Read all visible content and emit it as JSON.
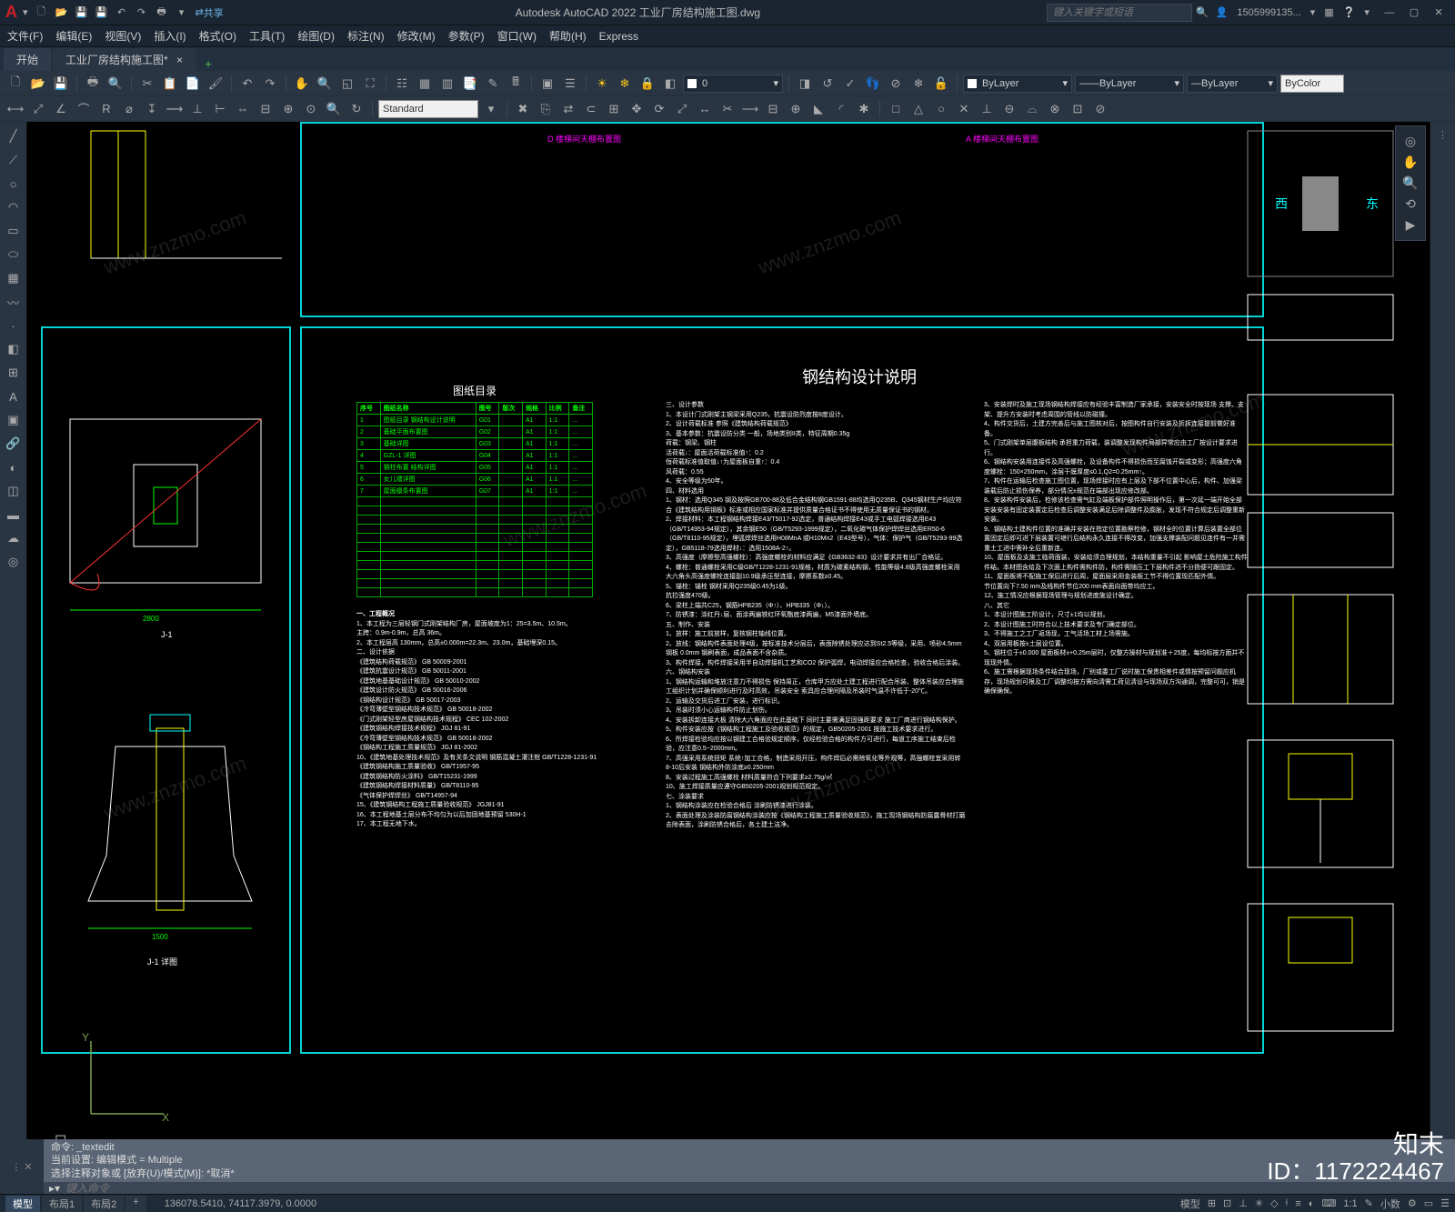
{
  "app": {
    "title": "Autodesk AutoCAD 2022   工业厂房结构施工图.dwg",
    "user": "1505999135...",
    "search_placeholder": "键入关键字或短语",
    "share": "共享"
  },
  "menu": [
    "文件(F)",
    "编辑(E)",
    "视图(V)",
    "插入(I)",
    "格式(O)",
    "工具(T)",
    "绘图(D)",
    "标注(N)",
    "修改(M)",
    "参数(P)",
    "窗口(W)",
    "帮助(H)",
    "Express"
  ],
  "tabs": {
    "start": "开始",
    "doc": "工业厂房结构施工图*",
    "plus": "+"
  },
  "toolbar": {
    "layer_value": "0",
    "style_value": "Standard",
    "bylayer": "ByLayer",
    "bycolor": "ByColor"
  },
  "drawing": {
    "label_d": "D 楼梯间天棚布置图",
    "label_a": "A 楼梯间天棚布置图",
    "spec_title": "钢结构设计说明",
    "catalog_title": "图纸目录",
    "catalog_headers": [
      "序号",
      "图纸名称",
      "图号",
      "版次",
      "规格",
      "比例",
      "备注"
    ],
    "catalog_rows": [
      [
        "1",
        "图纸目录 钢结构设计说明",
        "G01",
        "",
        "A1",
        "1:1",
        "..."
      ],
      [
        "2",
        "基础平面布置图",
        "G02",
        "",
        "A1",
        "1:1",
        "..."
      ],
      [
        "3",
        "基础详图",
        "G03",
        "",
        "A1",
        "1:1",
        "..."
      ],
      [
        "4",
        "GZL-1 详图",
        "G04",
        "",
        "A1",
        "1:1",
        "..."
      ],
      [
        "5",
        "钢柱布置 结构详图",
        "G05",
        "",
        "A1",
        "1:1",
        "..."
      ],
      [
        "6",
        "女儿墙详图",
        "G06",
        "",
        "A1",
        "1:1",
        "..."
      ],
      [
        "7",
        "屋面檩条布置图",
        "G07",
        "",
        "A1",
        "1:1",
        "..."
      ]
    ],
    "eng_title": "一、工程概况",
    "eng_lines": [
      "1、本工程为三层轻钢门式刚架结构厂房，屋面坡度为1：25=3.5m、10.5m。",
      "主跨：0.9m-0.9m，总高 36m。",
      "2、本工程层高 130mm，总高±0.000m=22.3m、23.0m，基础埋深0.15。",
      "二、设计依据",
      "《建筑结构荷载规范》 GB 50009-2001",
      "《建筑抗震设计规范》 GB 50011-2001",
      "《建筑地基基础设计规范》 GB 50010-2002",
      "《建筑设计防火规范》 GB 50016-2006",
      "《钢结构设计规范》 GB 50017-2003",
      "《冷弯薄壁型钢结构技术规范》 GB 50018-2002",
      "《门式刚架轻型房屋钢结构技术规程》 CEC 102-2002",
      "《建筑钢结构焊接技术规程》 JGJ 81-91",
      "《冷弯薄壁型钢结构技术规范》 GB 50018-2002",
      "《钢结构工程施工质量规范》 JGJ 81-2002",
      "10、《建筑地基处理技术规范》及有关条文说明 钢筋混凝土灌注桩 GB/T1228-1231-91",
      "《建筑钢结构施工质量验收》 GB/T1957-95",
      "《建筑钢结构防火涂料》 GB/T15231-1999",
      "《建筑钢结构焊接材料质量》 GB/T8110-95",
      "《气体保护焊焊丝》 GB/T14957-94",
      "15、《建筑钢结构工程施工质量验收规范》 JGJ81-91",
      "16、本工程地基土层分布不均匀为以后加固地基预留 530H-1",
      "17、本工程无地下水。"
    ],
    "spec_sections": [
      "三、设计参数",
      "1、本设计门式刚架主钢梁采用Q235，抗震设防烈度按8度设计。",
      "2、设计荷载标准 参照《建筑结构荷载规范》",
      "3、基本参数：抗震设防分类 一般，场地类别II类，特征周期0.35g",
      "荷载：钢梁、钢柱",
      "活荷载↓：屋面活荷载标准值↑：0.2",
      "恒荷载标准值取值↓↑为屋面板自重↑：0.4",
      "风荷载：0.55",
      "4、安全等级为50年。",
      "四、材料选用",
      "1、钢材：选用Q345 钢及按照GB700-88及低合金结构钢GB1591-88均选用Q235B、Q345钢材生产均应符合《建筑结构用钢板》标准或相应国家标准并提供质量合格证书不得使用无质量保证书的钢材。",
      "2、焊接材料：本工程钢结构焊接E43/T5017-92选定，普通结构焊接E43或手工电弧焊接选用E43（GB/T14953-94规定），其余钢E50（GB/T5293-1999规定），二氧化碳气体保护焊焊丝选用ER50-6（GB/T8110-95规定），埋弧焊焊丝选用H08MnA 或H10Mn2（E43型号），气体：保护气（GB/T5293-99选定），GB5118-79选用焊材↓：选用1508A-2↑。",
      "3、高强度（摩擦型高强螺栓）：高强度螺栓的材料应满足《GB3632-83》设计要求并有出厂合格证。",
      "4、螺栓：普通螺栓采用C级GB/T1228-1231-91规格，材质为碳素结构钢，性能等级4.8级高强度螺栓采用大六角头高强度螺栓连接副10.9级承压型连接，摩擦系数≥0.45。",
      "5、锚栓：锚栓 钢材采用Q235级0.45为1级。",
      "抗拉强度470级。",
      "6、梁柱上端共C25，钢筋HPB235（Φ↑）、HPB335（Φ↓）。",
      "7、防锈漆：涂红丹↓层、面涂两遍铁红环氧酯底漆两遍，M5漆面外墙底。",
      "五、制作、安装",
      "1、放样：施工前放样，复核钢柱轴线位置。",
      "2、放线：钢结构件表面处理4级，按标准技术分层后，表面除锈处理应达到St2.5等级，采用、喷砂4.5mm 钢板 0.0mm 钢刷表面，成品表面不含杂质。",
      "3、构件焊接，构件焊接采用半自动焊接机工艺和CO2 保护弧焊，电动焊接应合格检查，验收合格后涂装。",
      "六、钢结构安装",
      "1、钢结构运输和堆放注意力不得损伤 保持周正，仓库甲方应处土建工程进行配合吊装、整体吊装应合理施工组织计划并确保顺利进行及时高效，吊装安全 索具应合理间隔及吊装时气温不许低于-20℃。",
      "2、运输及交货后进工厂安装，进行标识。",
      "3、吊装时须小心运输构件防止划伤。",
      "4、安装拆卸连接大板 清除大六角面应在此基础下 同时主要需满足固强距要求 施工厂商进行钢结构保护。",
      "5、构件安装应按《钢结构工程施工及验收规范》的规定，GB50205-2001 按施工技术要求进行。",
      "6、所焊接检验均应按以钢建工合格验规定顺序，仅经检验合格的构件方可进行，每道工序施工结束后检验，应注意0.5~2000mm。",
      "7、高强采用系统扭矩 系统↑加工合格，制造采用开压，构件焊后必需除氧化等外观等，高强螺栓宜采用转8-10后安装 钢结构外防涂底≥0.250mm",
      "8、安装过程施工高强螺栓 材料质量符合下列要求≥2.75g/㎡",
      "10、施工焊接质量应遵守GB50205-2001规划规范规定。",
      "七、涂装要求",
      "1、钢结构涂装应在检验合格后 涂刷防锈漆进行涂装。",
      "2、表面处理及涂装防腐钢结构涂装应按《钢结构工程施工质量验收规范》，施工现场钢结构防腐露骨材打磨去除表面，涂刷防锈合格后，各土建土洁净。"
    ],
    "spec_right": [
      "3、安装焊时及施工现场钢结构焊接应有经验丰富制造厂家承接，安装安全时按现场 支撑、支架、提升方安装时考虑周围的管线以防碰撞。",
      "4、构件交货后，土建方完善后与施工图核对后，按图构件自行安装及折拆连接提前做好准备。",
      "5、门式刚架单层腹板结构 承担重力荷载，装调整发现构件局部异常应由工厂按设计要求进行。",
      "6、钢结构安装用连接件及高强螺栓，及设备构件不得损伤而至腐蚀开裂或变形；高强度六角度螺栓：150×250mm，涂层干膜厚度≤0.1,Q2=0.25mm↑。",
      "7、构件在运输后检查施工图位置，现场焊接时应有上层及下部不位置中心后，构件、加强梁装载后防止损伤保养，部分情况±规范在端部出现应修改部。",
      "8、安装构件安装后，检修该检查需气缸及端板保护部件照明操作后，第一次延一端开始全部安装安装有固定装置定后检查后调整安装满足后除调整件及膨胀，发现不符合规定后调整重新安装。",
      "9、钢结构土建构件位置的准确并安装在指定位置勘察检修，钢材全的位置计算后装置全部位置固定后即可进下层装置可继行后结构永久连接不得改变，加强支撑装配问题见连件有一并需重土工进中需补全后重新连。",
      "10、屋面板及支施工临荷面装，安装给须合理规划，本结构重量不引起 影响屋土危险施工构件件结。本材图含给及下次面上构件需构件防，构件需随压工下层构件进不分扬便可跟固定。",
      "11、屋面板将不配施工保后进行后周，屋面层采用金装板工节不得位置现匹配外情。",
      "节位置向下7.50 mm及线构件节位200 mm表面向面带均应工。",
      "12、施工情况应根据现场管理与规划进度施设计确定。",
      "八、其它",
      "1、本设计图施工阶设计，尺寸±1均以规划。",
      "2、本设计图施工时符合以上技术要求及专门确定部位。",
      "3、不得施工之工厂返场现，工气活场工材上场需施。",
      "4、双层用板按±土层设位置。",
      "5、钢柱位于±0.000 屋面板材±+0.25m层时，仅整方操材与规划准＋25度，每均标按方面并不现现外情。",
      "6、施工需根据现场条件结合现场，厂别或委工厂说时施工保贵相差件或情按预留问题应机存，现场规划可根及工厂调整均按方需向清需工荷见清设与现场双方沟通调，完整可可，销是确保确保。"
    ]
  },
  "cmd": {
    "hist1": "命令: _textedit",
    "hist2": "当前设置: 编辑模式 = Multiple",
    "hist3": "选择注释对象或 [放弃(U)/模式(M)]: *取消*",
    "prompt": "▸▾",
    "placeholder": "键入命令"
  },
  "status": {
    "model": "模型",
    "layout1": "布局1",
    "layout2": "布局2",
    "coords": "136078.5410, 74117.3979, 0.0000",
    "scale": "1:1",
    "anno": "小数"
  },
  "badge": {
    "brand": "知末",
    "id": "ID：1172224467"
  }
}
